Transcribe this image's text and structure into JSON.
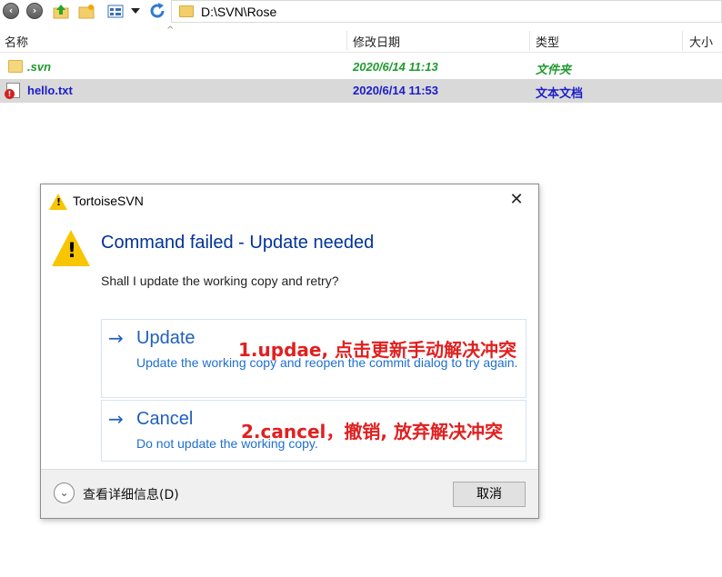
{
  "toolbar": {
    "address": "D:\\SVN\\Rose"
  },
  "columns": {
    "name": "名称",
    "modified": "修改日期",
    "type": "类型",
    "size": "大小"
  },
  "files": [
    {
      "name": ".svn",
      "modified": "2020/6/14 11:13",
      "type": "文件夹"
    },
    {
      "name": "hello.txt",
      "modified": "2020/6/14 11:53",
      "type": "文本文档"
    }
  ],
  "dialog": {
    "title": "TortoiseSVN",
    "close_glyph": "✕",
    "main_instruction": "Command failed - Update needed",
    "content": "Shall I update the working copy and retry?",
    "commands": [
      {
        "label": "Update",
        "description": "Update the working copy and reopen the commit dialog to try again.",
        "annotation": "1.updae, 点击更新手动解决冲突"
      },
      {
        "label": "Cancel",
        "description": "Do not update the working copy.",
        "annotation": "2.cancel，撤销, 放弃解决冲突"
      }
    ],
    "details_label": "查看详细信息(D)",
    "cancel_button": "取消"
  },
  "colors": {
    "accent_blue": "#1f5fbf",
    "svn_green": "#1e9b2e",
    "selected_blue": "#1c1cc8",
    "annotation_red": "#e02020",
    "warning_yellow": "#f7c600"
  }
}
